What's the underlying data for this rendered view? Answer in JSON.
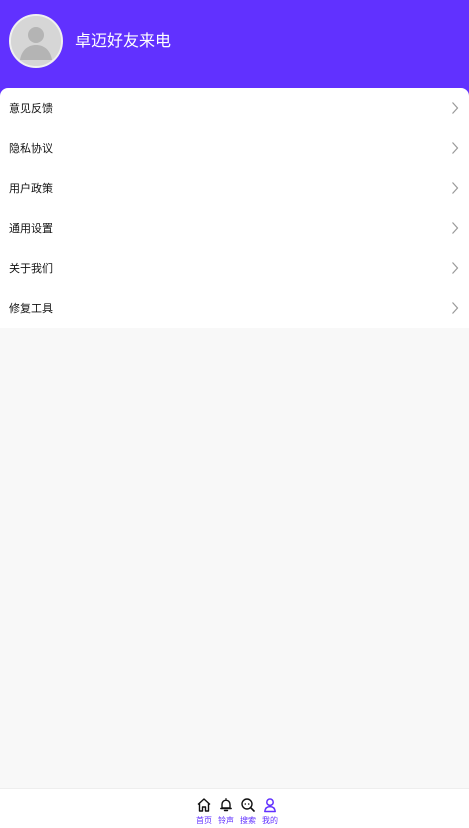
{
  "header": {
    "app_name": "卓迈好友来电",
    "background_color": "#6131ff"
  },
  "menu": {
    "items": [
      {
        "label": "意见反馈"
      },
      {
        "label": "隐私协议"
      },
      {
        "label": "用户政策"
      },
      {
        "label": "通用设置"
      },
      {
        "label": "关于我们"
      },
      {
        "label": "修复工具"
      }
    ]
  },
  "tabbar": {
    "accent_color": "#6131ff",
    "tabs": [
      {
        "label": "首页",
        "icon": "home-icon"
      },
      {
        "label": "铃声",
        "icon": "bell-icon"
      },
      {
        "label": "搜索",
        "icon": "search-icon"
      },
      {
        "label": "我的",
        "icon": "user-icon",
        "active": true
      }
    ]
  }
}
